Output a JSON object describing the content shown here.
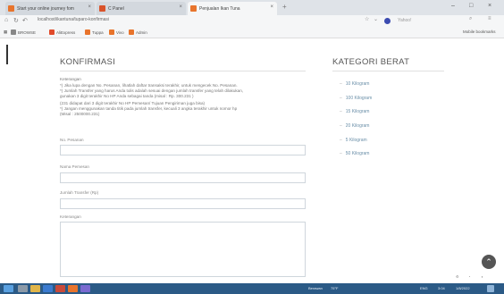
{
  "browser": {
    "tabs": [
      {
        "label": "Start your online journey fom"
      },
      {
        "label": "C Panel"
      },
      {
        "label": "Penjualan Ikan Tuna"
      }
    ],
    "new_tab": "+",
    "url": "localhost/ikantuna/tuparo-konfirmasi",
    "search_engine": "Yahoo!",
    "window_controls": {
      "minimize": "–",
      "maximize": "□",
      "close": "×"
    },
    "bookmarks": [
      {
        "label": "BROWSE",
        "color": "#888888"
      },
      {
        "label": "AliExpress",
        "color": "#e04a2a"
      },
      {
        "label": "Tuppa",
        "color": "#e8742c"
      },
      {
        "label": "Vivo",
        "color": "#e8742c"
      },
      {
        "label": "Admin",
        "color": "#e8742c"
      }
    ],
    "bookmarks_right": "Mobile bookmarks"
  },
  "main": {
    "title": "KONFIRMASI",
    "notes": [
      "Keterangan",
      "*) Jika lupa dengan No. Pesanan, lihatlah daftar transaksi terakhir, untuk mengecek No. Pesanan.",
      "*) Jumlah Transfer yang harus Anda tulis adalah sesuai dengan jumlah transfer yang telah dilakukan,",
      "gunakan 3 digit terakhir No HP Anda sebagai tanda (misal : Rp. 300.231 )",
      "(231 didapat dari 3 digit terakhir No HP Pemesan/ Tujuan Pengiriman juga bisa)",
      "*) Jangan menggunakan tanda titik pada jumlah transfer, kecuali 3 angka terakhir untuk nomor hp",
      "(Misal : 2500000.231)"
    ],
    "fields": {
      "no_pesanan": "No. Pesanan",
      "nama_pemesan": "Nama Pemesan",
      "jumlah_transfer": "Jumlah Transfer (Rp)",
      "keterangan": "Keterangan"
    }
  },
  "sidebar": {
    "title": "KATEGORI BERAT",
    "items": [
      {
        "label": "10 Kilogram"
      },
      {
        "label": "100 Kilogram"
      },
      {
        "label": "15 Kilogram"
      },
      {
        "label": "20 Kilogram"
      },
      {
        "label": "5 Kilogram"
      },
      {
        "label": "50 Kilogram"
      }
    ]
  },
  "scroll_top_icon": "chevron-up-icon",
  "taskbar": {
    "weather": "Berawan",
    "temperature": "75°F",
    "language": "ENG",
    "time": "3:04",
    "date": "1/8/2022"
  }
}
